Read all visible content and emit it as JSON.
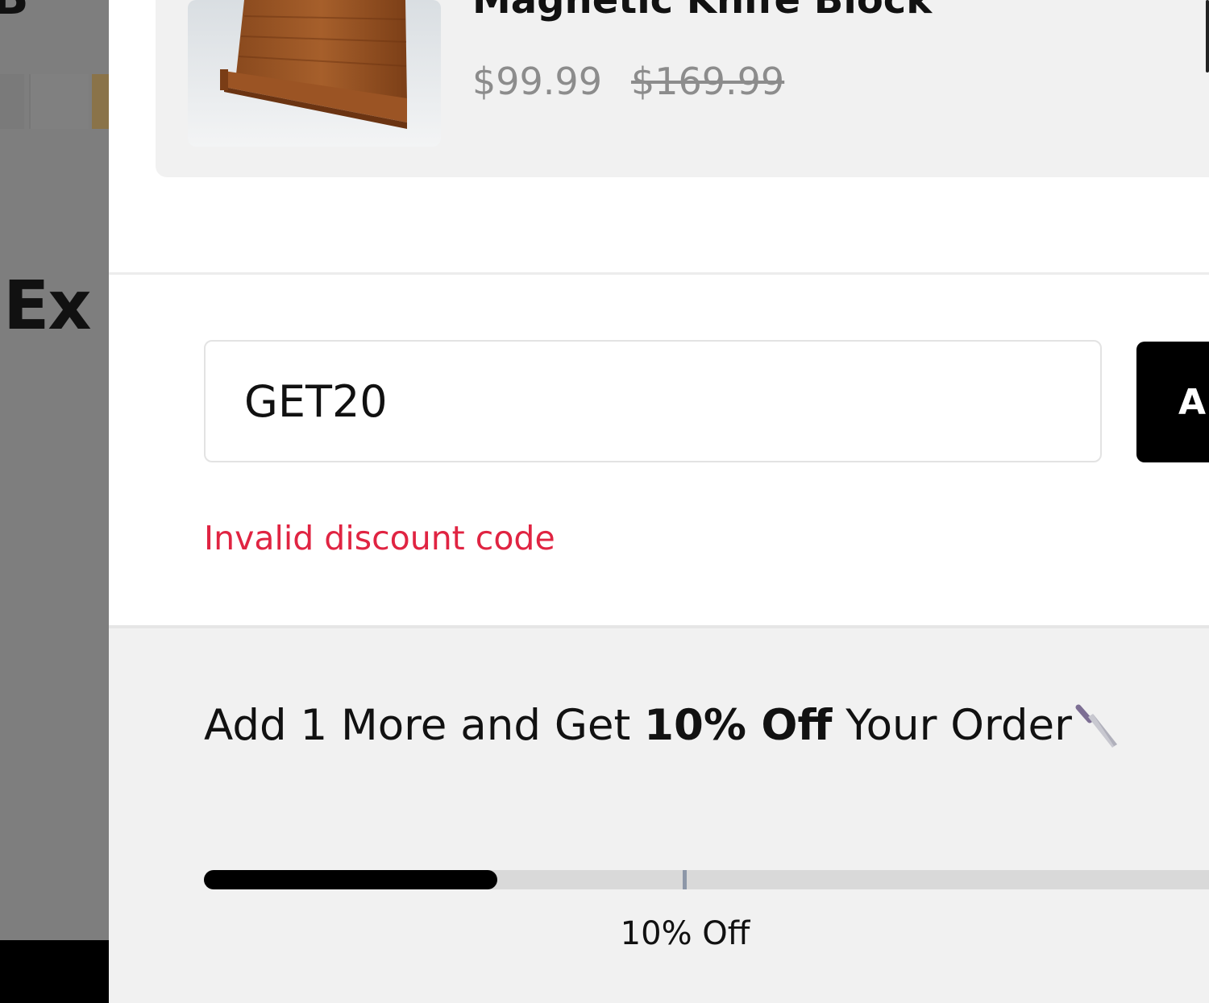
{
  "background_page": {
    "heading": "Ex"
  },
  "product": {
    "title": "Magnetic Knife Block",
    "sale_price": "$99.99",
    "compare_price": "$169.99"
  },
  "discount": {
    "value": "GET20",
    "apply_label": "A",
    "error": "Invalid discount code"
  },
  "promo": {
    "prefix": "Add 1 More and Get ",
    "highlight": "10% Off",
    "suffix": " Your Order",
    "icon": "knife-icon",
    "progress_fraction": 0.28,
    "milestone_label": "10% Off"
  },
  "colors": {
    "error": "#e02442",
    "accent": "#000000",
    "panel": "#f1f1f1"
  }
}
